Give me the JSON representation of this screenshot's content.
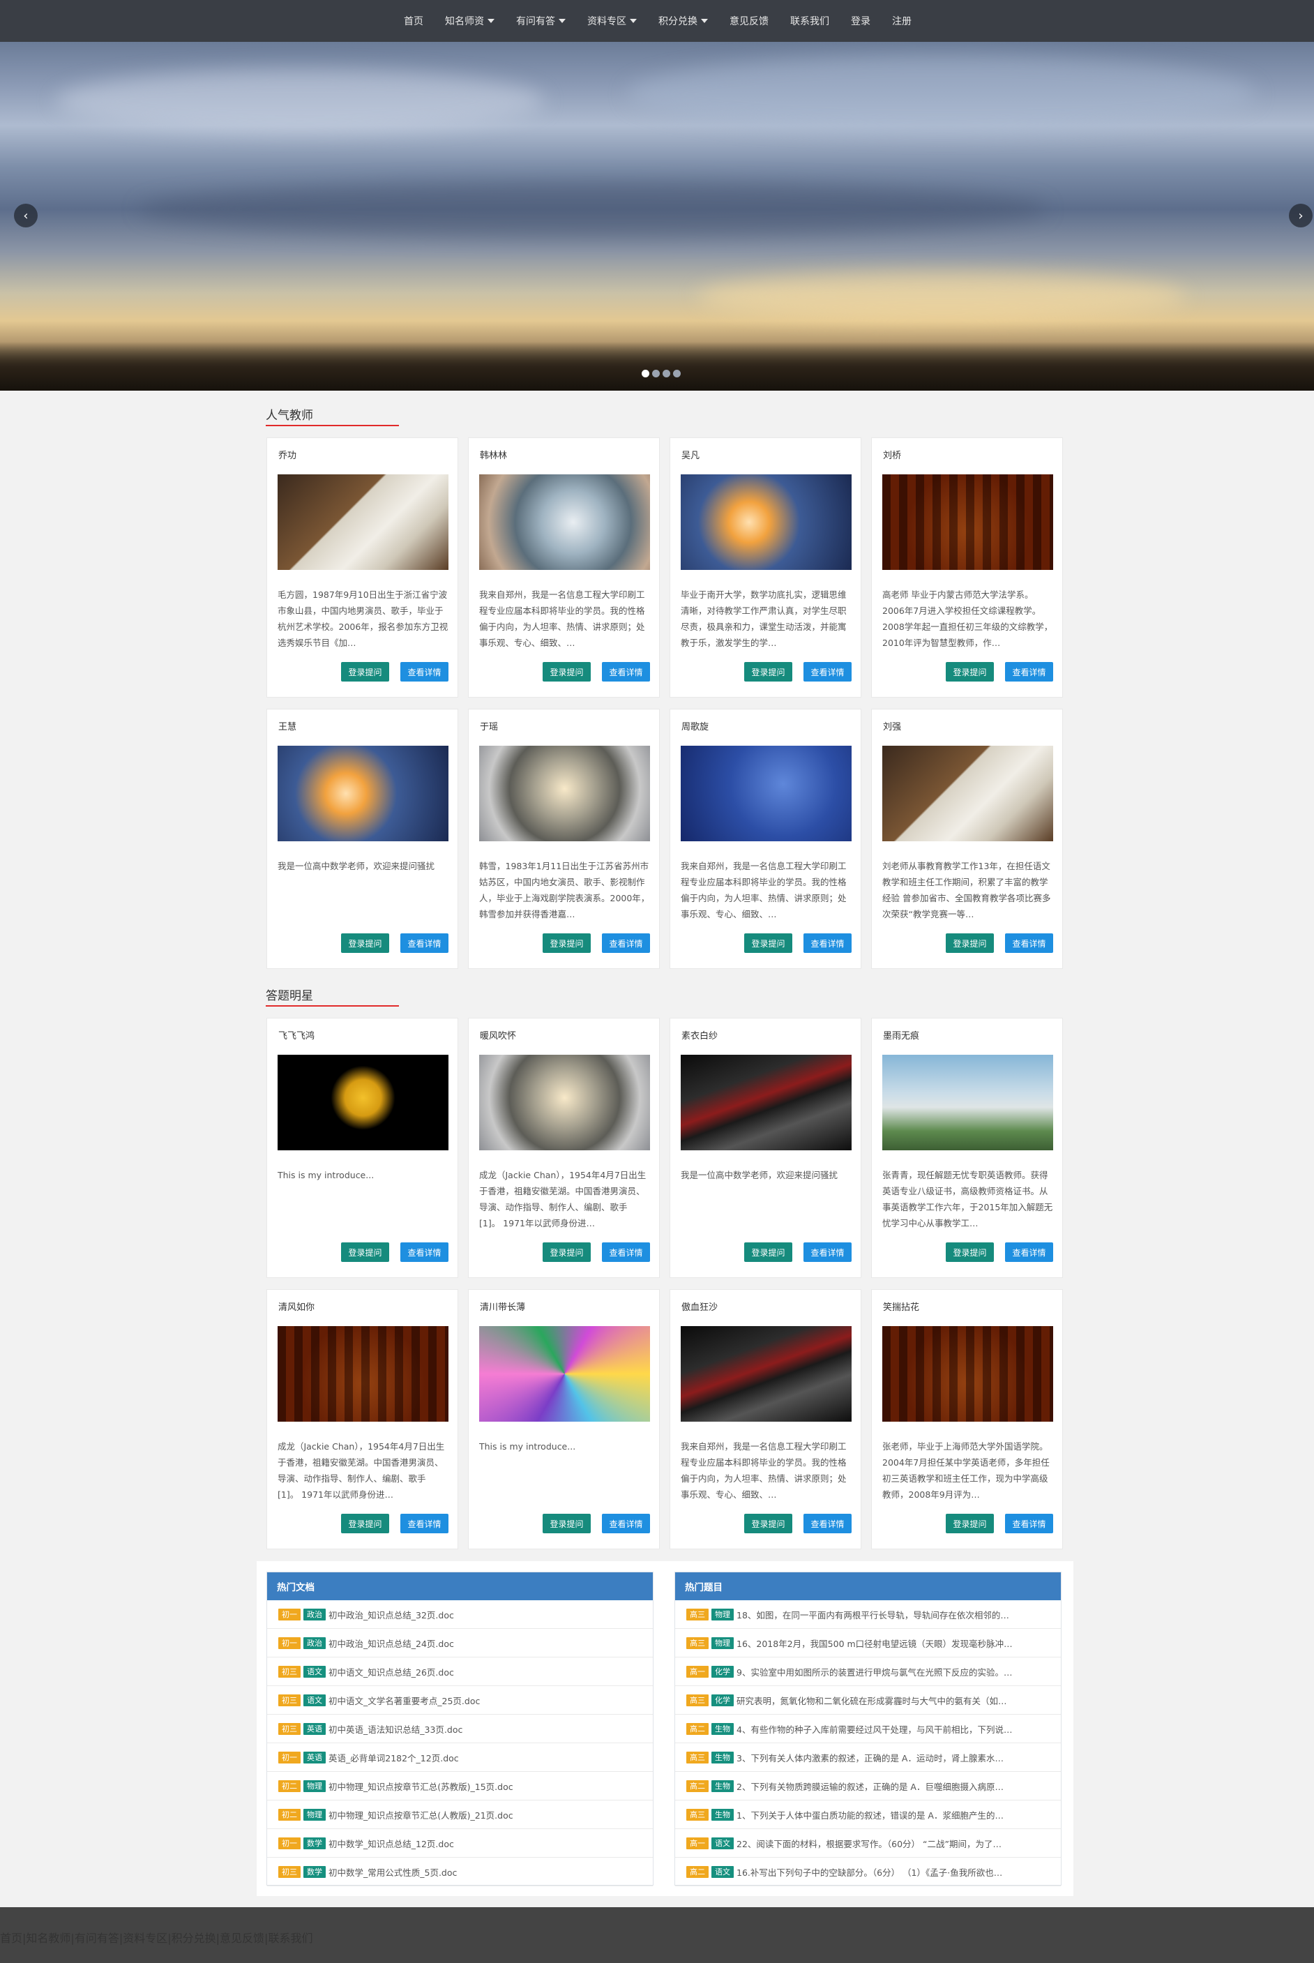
{
  "nav": {
    "items": [
      {
        "label": "首页",
        "dropdown": false
      },
      {
        "label": "知名师资",
        "dropdown": true
      },
      {
        "label": "有问有答",
        "dropdown": true
      },
      {
        "label": "资料专区",
        "dropdown": true
      },
      {
        "label": "积分兑换",
        "dropdown": true
      },
      {
        "label": "意见反馈",
        "dropdown": false
      },
      {
        "label": "联系我们",
        "dropdown": false
      },
      {
        "label": "登录",
        "dropdown": false
      },
      {
        "label": "注册",
        "dropdown": false
      }
    ]
  },
  "hero": {
    "prev": "‹",
    "next": "›",
    "slide_count": 4,
    "active_slide": 1
  },
  "popular_teachers": {
    "title": "人气教师",
    "cards": [
      {
        "name": "乔功",
        "image": "notebook",
        "desc": "毛方圆，1987年9月10日出生于浙江省宁波市象山县，中国内地男演员、歌手，毕业于杭州艺术学校。2006年，报名参加东方卫视选秀娱乐节目《加…"
      },
      {
        "name": "韩林林",
        "image": "astronaut",
        "desc": "我来自郑州，我是一名信息工程大学印刷工程专业应届本科即将毕业的学员。我的性格偏于内向，为人坦率、热情、讲求原则；处事乐观、专心、细致、…"
      },
      {
        "name": "吴凡",
        "image": "robot",
        "desc": "毕业于南开大学，数学功底扎实，逻辑思维清晰，对待教学工作严肃认真，对学生尽职尽责，极具亲和力，课堂生动活泼，并能寓教于乐，激发学生的学…"
      },
      {
        "name": "刘桥",
        "image": "tunnel",
        "desc": "高老师 毕业于内蒙古师范大学法学系。2006年7月进入学校担任文综课程教学。2008学年起一直担任初三年级的文综教学，2010年评为智慧型教师，作…"
      },
      {
        "name": "王慧",
        "image": "robot",
        "desc": "我是一位高中数学老师，欢迎来提问骚扰"
      },
      {
        "name": "于瑶",
        "image": "globe",
        "desc": "韩雪，1983年1月11日出生于江苏省苏州市姑苏区，中国内地女演员、歌手、影视制作人，毕业于上海戏剧学院表演系。2000年，韩雪参加并获得香港嘉…"
      },
      {
        "name": "周歌旋",
        "image": "blue",
        "desc": "我来自郑州，我是一名信息工程大学印刷工程专业应届本科即将毕业的学员。我的性格偏于内向，为人坦率、热情、讲求原则；处事乐观、专心、细致、…"
      },
      {
        "name": "刘强",
        "image": "notebook",
        "desc": "刘老师从事教育教学工作13年，在担任语文教学和班主任工作期间，积累了丰富的教学经验 曾参加省市、全国教育教学各项比赛多次荣获“教学竞赛一等…"
      }
    ]
  },
  "answer_stars": {
    "title": "答题明星",
    "cards": [
      {
        "name": "飞飞飞鸿",
        "image": "smile",
        "desc": "This is my introduce..."
      },
      {
        "name": "暖风吹怀",
        "image": "globe",
        "desc": "成龙（Jackie Chan），1954年4月7日出生于香港，祖籍安徽芜湖。中国香港男演员、导演、动作指导、制作人、编剧、歌手 [1]。 1971年以武师身份进…"
      },
      {
        "name": "素衣白纱",
        "image": "waves",
        "desc": "我是一位高中数学老师，欢迎来提问骚扰"
      },
      {
        "name": "墨雨无痕",
        "image": "house",
        "desc": "张青青，现任解题无忧专职英语教师。获得英语专业八级证书，高级教师资格证书。从事英语教学工作六年，于2015年加入解题无忧学习中心从事教学工…"
      },
      {
        "name": "清风如你",
        "image": "tunnel",
        "desc": "成龙（Jackie Chan），1954年4月7日出生于香港，祖籍安徽芜湖。中国香港男演员、导演、动作指导、制作人、编剧、歌手 [1]。 1971年以武师身份进…"
      },
      {
        "name": "清川带长薄",
        "image": "spiral",
        "desc": "This is my introduce..."
      },
      {
        "name": "傲血狂沙",
        "image": "waves",
        "desc": "我来自郑州，我是一名信息工程大学印刷工程专业应届本科即将毕业的学员。我的性格偏于内向，为人坦率、热情、讲求原则；处事乐观、专心、细致、…"
      },
      {
        "name": "笑揣拈花",
        "image": "tunnel",
        "desc": "张老师，毕业于上海师范大学外国语学院。2004年7月担任某中学英语老师，多年担任初三英语教学和班主任工作，现为中学高级教师，2008年9月评为…"
      }
    ]
  },
  "buttons": {
    "login": "登录提问",
    "detail": "查看详情"
  },
  "hot_docs": {
    "title": "热门文档",
    "rows": [
      {
        "grade": "初一",
        "subject": "政治",
        "text": "初中政治_知识点总结_32页.doc"
      },
      {
        "grade": "初一",
        "subject": "政治",
        "text": "初中政治_知识点总结_24页.doc"
      },
      {
        "grade": "初三",
        "subject": "语文",
        "text": "初中语文_知识点总结_26页.doc"
      },
      {
        "grade": "初三",
        "subject": "语文",
        "text": "初中语文_文学名著重要考点_25页.doc"
      },
      {
        "grade": "初三",
        "subject": "英语",
        "text": "初中英语_语法知识总结_33页.doc"
      },
      {
        "grade": "初一",
        "subject": "英语",
        "text": "英语_必背单词2182个_12页.doc"
      },
      {
        "grade": "初二",
        "subject": "物理",
        "text": "初中物理_知识点按章节汇总(苏教版)_15页.doc"
      },
      {
        "grade": "初二",
        "subject": "物理",
        "text": "初中物理_知识点按章节汇总(人教版)_21页.doc"
      },
      {
        "grade": "初一",
        "subject": "数学",
        "text": "初中数学_知识点总结_12页.doc"
      },
      {
        "grade": "初三",
        "subject": "数学",
        "text": "初中数学_常用公式性质_5页.doc"
      }
    ]
  },
  "hot_questions": {
    "title": "热门题目",
    "rows": [
      {
        "grade": "高三",
        "subject": "物理",
        "text": "18、如图，在同一平面内有两根平行长导轨，导轨间存在依次相邻的…"
      },
      {
        "grade": "高三",
        "subject": "物理",
        "text": "16、2018年2月，我国500 m口径射电望远镜（天眼）发现毫秒脉冲…"
      },
      {
        "grade": "高一",
        "subject": "化学",
        "text": "9、实验室中用如图所示的装置进行甲烷与氯气在光照下反应的实验。…"
      },
      {
        "grade": "高三",
        "subject": "化学",
        "text": "研究表明，氮氧化物和二氧化硫在形成雾霾时与大气中的氨有关（如…"
      },
      {
        "grade": "高二",
        "subject": "生物",
        "text": "4、有些作物的种子入库前需要经过风干处理，与风干前相比，下列说…"
      },
      {
        "grade": "高三",
        "subject": "生物",
        "text": "3、下列有关人体内激素的叙述，正确的是 A．运动时，肾上腺素水…"
      },
      {
        "grade": "高二",
        "subject": "生物",
        "text": "2、下列有关物质跨膜运输的叙述，正确的是 A．巨噬细胞摄入病原…"
      },
      {
        "grade": "高三",
        "subject": "生物",
        "text": "1、下列关于人体中蛋白质功能的叙述，错误的是 A．浆细胞产生的…"
      },
      {
        "grade": "高一",
        "subject": "语文",
        "text": "22、阅读下面的材料，根据要求写作。（60分） “二战”期间，为了…"
      },
      {
        "grade": "高二",
        "subject": "语文",
        "text": "16.补写出下列句子中的空缺部分。（6分） （1）《孟子·鱼我所欲也…"
      }
    ]
  },
  "footer": {
    "links": [
      "首页",
      "知名教师",
      "有问有答",
      "资料专区",
      "积分兑换",
      "意见反馈",
      "联系我们"
    ]
  }
}
